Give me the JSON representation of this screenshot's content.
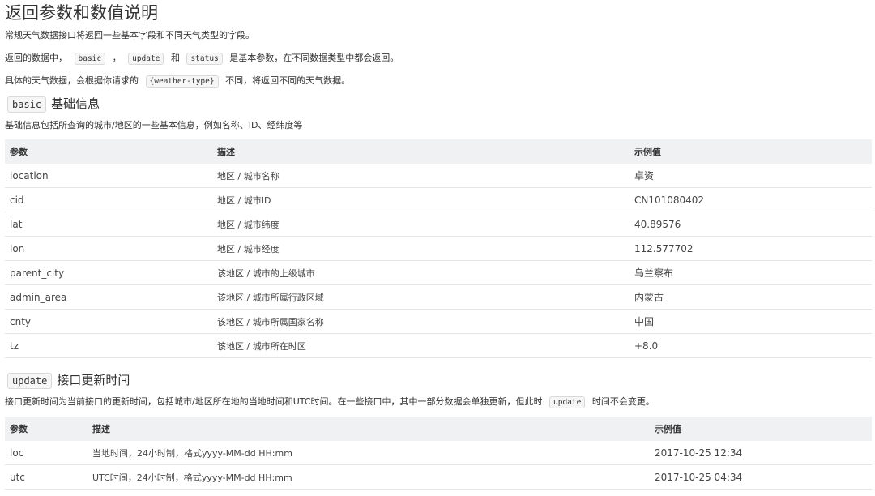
{
  "title": "返回参数和数值说明",
  "intro": {
    "line1": "常规天气数据接口将返回一些基本字段和不同天气类型的字段。",
    "line2": {
      "prefix": "返回的数据中，",
      "code1": "basic",
      "sep1": "，",
      "code2": "update",
      "sep2": "和",
      "code3": "status",
      "suffix": "是基本参数，在不同数据类型中都会返回。"
    },
    "line3": {
      "prefix": "具体的天气数据，会根据你请求的",
      "code": "{weather-type}",
      "suffix": "不同，将返回不同的天气数据。"
    }
  },
  "basic_section": {
    "code": "basic",
    "heading": "基础信息",
    "description": "基础信息包括所查询的城市/地区的一些基本信息，例如名称、ID、经纬度等",
    "headers": [
      "参数",
      "描述",
      "示例值"
    ],
    "rows": [
      [
        "location",
        "地区 / 城市名称",
        "卓资"
      ],
      [
        "cid",
        "地区 / 城市ID",
        "CN101080402"
      ],
      [
        "lat",
        "地区 / 城市纬度",
        "40.89576"
      ],
      [
        "lon",
        "地区 / 城市经度",
        "112.577702"
      ],
      [
        "parent_city",
        "该地区 / 城市的上级城市",
        "乌兰察布"
      ],
      [
        "admin_area",
        "该地区 / 城市所属行政区域",
        "内蒙古"
      ],
      [
        "cnty",
        "该地区 / 城市所属国家名称",
        "中国"
      ],
      [
        "tz",
        "该地区 / 城市所在时区",
        "+8.0"
      ]
    ]
  },
  "update_section": {
    "code": "update",
    "heading": "接口更新时间",
    "description": {
      "prefix": "接口更新时间为当前接口的更新时间，包括城市/地区所在地的当地时间和UTC时间。在一些接口中，其中一部分数据会单独更新，但此时",
      "code": "update",
      "suffix": "时间不会变更。"
    },
    "headers": [
      "参数",
      "描述",
      "示例值"
    ],
    "rows": [
      [
        "loc",
        "当地时间，24小时制，格式yyyy-MM-dd HH:mm",
        "2017-10-25 12:34"
      ],
      [
        "utc",
        "UTC时间，24小时制，格式yyyy-MM-dd HH:mm",
        "2017-10-25 04:34"
      ]
    ]
  }
}
